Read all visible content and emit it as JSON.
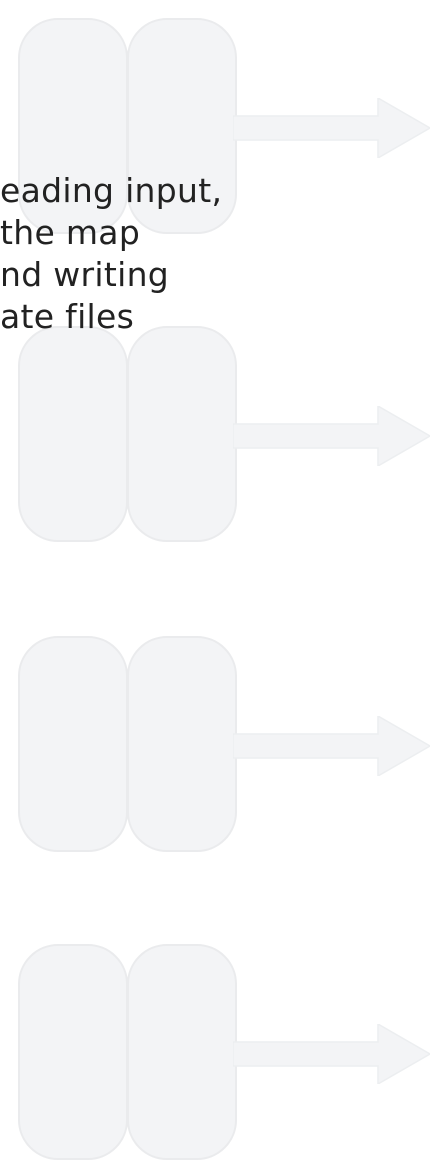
{
  "caption": {
    "line1": "eading input,",
    "line2": " the map",
    "line3": "nd writing",
    "line4": "ate files"
  },
  "colors": {
    "pill_fill": "#f3f4f6",
    "pill_border": "#eaebed",
    "arrow_fill": "#f3f4f6",
    "text": "#222222"
  }
}
